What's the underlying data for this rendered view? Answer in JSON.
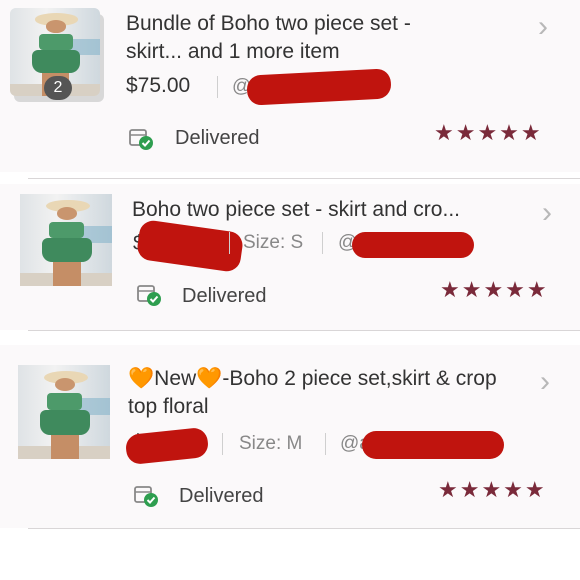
{
  "orders": [
    {
      "badge_count": "2",
      "title": "Bundle of Boho two piece set - skirt... and 1 more item",
      "price": "$75.00",
      "at_prefix": "@",
      "size": "",
      "status": "Delivered",
      "rating_stars": "★★★★★",
      "rating": 5
    },
    {
      "title": "Boho two piece set - skirt and cro...",
      "price_prefix": "$",
      "size": "Size: S",
      "at_prefix": "@",
      "status": "Delivered",
      "rating_stars": "★★★★★",
      "rating": 5
    },
    {
      "title_heart1": "🧡",
      "title_new": "New",
      "title_heart2": "🧡",
      "title_rest": "-Boho 2 piece set,skirt & crop top floral",
      "price_prefix": "$",
      "size": "Size: M",
      "at_prefix": "@a",
      "status": "Delivered",
      "rating_stars": "★★★★★",
      "rating": 5
    }
  ],
  "icons": {
    "chevron": "chevron-right-icon",
    "delivered": "package-check-icon",
    "star": "star-icon"
  },
  "colors": {
    "star": "#7a2a3a",
    "check_green": "#2e9e4f",
    "redaction": "#c0140e"
  }
}
